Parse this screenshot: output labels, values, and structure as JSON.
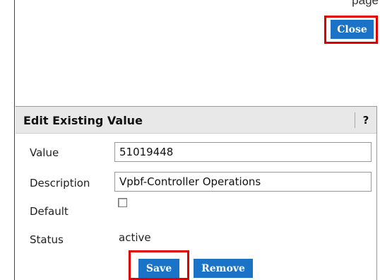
{
  "window": {
    "top_partial_text": "page"
  },
  "toolbar": {
    "close_label": "Close"
  },
  "dialog": {
    "title": "Edit Existing Value",
    "help_label": "?",
    "fields": {
      "value_label": "Value",
      "value": "51019448",
      "description_label": "Description",
      "description": "Vpbf-Controller Operations",
      "default_label": "Default",
      "default_checked": false,
      "status_label": "Status",
      "status_value": "active"
    },
    "buttons": {
      "save_label": "Save",
      "remove_label": "Remove"
    }
  },
  "colors": {
    "button_blue": "#1a73c7",
    "highlight_red": "#e00000",
    "header_gray": "#e8e8e8"
  }
}
